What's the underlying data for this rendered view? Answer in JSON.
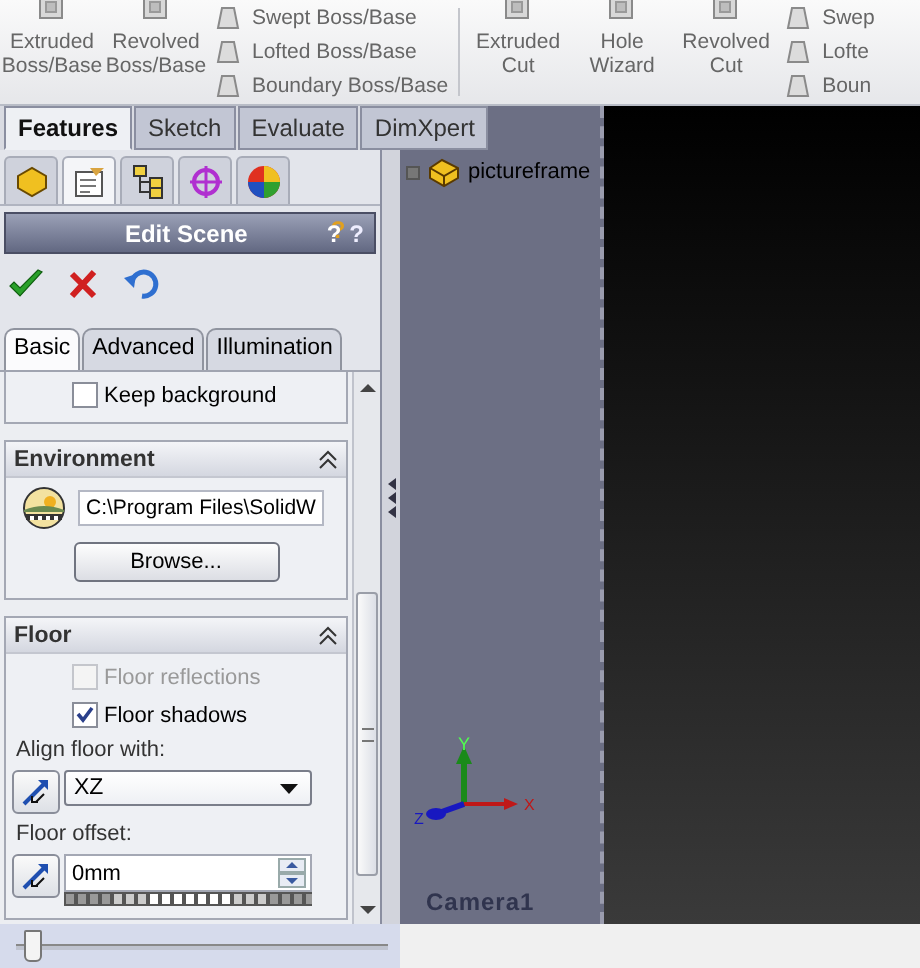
{
  "toolbar": {
    "groups": [
      {
        "items": [
          {
            "kind": "large",
            "label": "Extruded Boss/Base"
          },
          {
            "kind": "large",
            "label": "Revolved Boss/Base"
          },
          {
            "kind": "stack",
            "entries": [
              "Swept Boss/Base",
              "Lofted Boss/Base",
              "Boundary Boss/Base"
            ]
          }
        ]
      },
      {
        "items": [
          {
            "kind": "large",
            "label": "Extruded Cut"
          },
          {
            "kind": "large",
            "label": "Hole Wizard"
          },
          {
            "kind": "large",
            "label": "Revolved Cut"
          },
          {
            "kind": "stack",
            "entries": [
              "Swep",
              "Lofte",
              "Boun"
            ]
          }
        ]
      }
    ]
  },
  "command_tabs": [
    {
      "label": "Features",
      "selected": true
    },
    {
      "label": "Sketch",
      "selected": false
    },
    {
      "label": "Evaluate",
      "selected": false
    },
    {
      "label": "DimXpert",
      "selected": false
    }
  ],
  "panel_tabs": [
    {
      "selected": false
    },
    {
      "selected": true
    },
    {
      "selected": false
    },
    {
      "selected": false
    },
    {
      "selected": false
    }
  ],
  "property_manager": {
    "title": "Edit Scene",
    "help_buttons": [
      "?",
      "?"
    ],
    "subtabs": [
      {
        "label": "Basic",
        "selected": true
      },
      {
        "label": "Advanced",
        "selected": false
      },
      {
        "label": "Illumination",
        "selected": false
      }
    ],
    "sections": [
      {
        "kind": "partial",
        "rows": [
          {
            "kind": "checkbox",
            "label": "Keep background",
            "checked": false,
            "disabled": false
          }
        ]
      },
      {
        "kind": "group",
        "title": "Environment",
        "expanded": true,
        "rows": [
          {
            "kind": "file",
            "value": "C:\\Program Files\\SolidW"
          },
          {
            "kind": "button",
            "label": "Browse..."
          }
        ]
      },
      {
        "kind": "group",
        "title": "Floor",
        "expanded": true,
        "rows": [
          {
            "kind": "checkbox",
            "label": "Floor reflections",
            "checked": false,
            "disabled": true
          },
          {
            "kind": "checkbox",
            "label": "Floor shadows",
            "checked": true,
            "disabled": false
          },
          {
            "kind": "label",
            "text": "Align floor with:"
          },
          {
            "kind": "select",
            "value": "XZ"
          },
          {
            "kind": "label",
            "text": "Floor offset:"
          },
          {
            "kind": "spin",
            "value": "0mm"
          }
        ]
      }
    ]
  },
  "viewport": {
    "tree_item": "pictureframe",
    "triad_labels": [
      "X",
      "Y",
      "Z"
    ],
    "view_label": "Camera1"
  },
  "bottom_slider": {
    "level": 0.02
  }
}
